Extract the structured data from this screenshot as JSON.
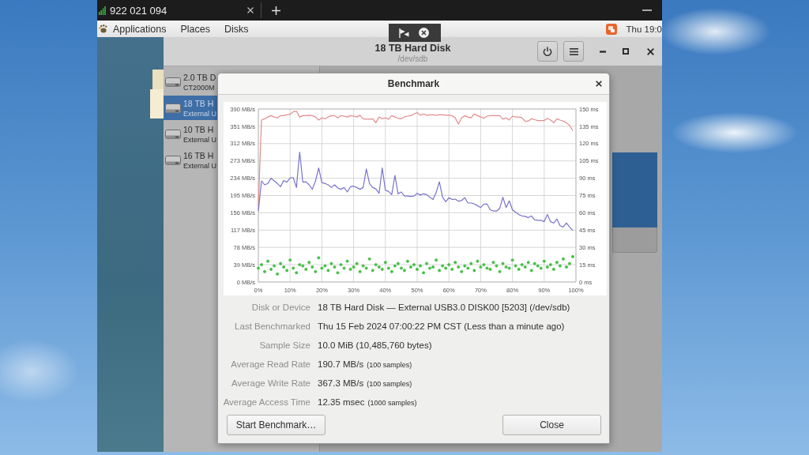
{
  "tab_bar": {
    "tab_title": "922 021 094"
  },
  "top_panel": {
    "menus": [
      "Applications",
      "Places",
      "Disks"
    ],
    "clock": "Thu 19:0"
  },
  "disks_window": {
    "title": "18 TB Hard Disk",
    "subtitle": "/dev/sdb",
    "sidebar": {
      "items": [
        {
          "name": "2.0 TB D",
          "detail": "CT2000M",
          "selected": false
        },
        {
          "name": "18 TB H",
          "detail": "External U",
          "selected": true
        },
        {
          "name": "10 TB H",
          "detail": "External U",
          "selected": false
        },
        {
          "name": "16 TB H",
          "detail": "External U",
          "selected": false
        }
      ]
    }
  },
  "benchmark_dialog": {
    "title": "Benchmark",
    "chart_data": {
      "type": "line",
      "grid": true,
      "xlim": [
        0,
        100
      ],
      "ylim": [
        0,
        390
      ],
      "y2lim": [
        0,
        150
      ],
      "x": [
        0,
        1,
        2,
        3,
        4,
        5,
        6,
        7,
        8,
        9,
        10,
        11,
        12,
        13,
        14,
        15,
        16,
        17,
        18,
        19,
        20,
        21,
        22,
        23,
        24,
        25,
        26,
        27,
        28,
        29,
        30,
        31,
        32,
        33,
        34,
        35,
        36,
        37,
        38,
        39,
        40,
        41,
        42,
        43,
        44,
        45,
        46,
        47,
        48,
        49,
        50,
        51,
        52,
        53,
        54,
        55,
        56,
        57,
        58,
        59,
        60,
        61,
        62,
        63,
        64,
        65,
        66,
        67,
        68,
        69,
        70,
        71,
        72,
        73,
        74,
        75,
        76,
        77,
        78,
        79,
        80,
        81,
        82,
        83,
        84,
        85,
        86,
        87,
        88,
        89,
        90,
        91,
        92,
        93,
        94,
        95,
        96,
        97,
        98,
        99
      ],
      "xticks": [
        {
          "value": 0,
          "label": "0%"
        },
        {
          "value": 10,
          "label": "10%"
        },
        {
          "value": 20,
          "label": "20%"
        },
        {
          "value": 30,
          "label": "30%"
        },
        {
          "value": 40,
          "label": "40%"
        },
        {
          "value": 50,
          "label": "50%"
        },
        {
          "value": 60,
          "label": "60%"
        },
        {
          "value": 70,
          "label": "70%"
        },
        {
          "value": 80,
          "label": "80%"
        },
        {
          "value": 90,
          "label": "90%"
        },
        {
          "value": 100,
          "label": "100%"
        }
      ],
      "yticks": [
        {
          "value": 0,
          "label": "0 MB/s"
        },
        {
          "value": 39,
          "label": "39 MB/s"
        },
        {
          "value": 78,
          "label": "78 MB/s"
        },
        {
          "value": 117,
          "label": "117 MB/s"
        },
        {
          "value": 156,
          "label": "156 MB/s"
        },
        {
          "value": 195,
          "label": "195 MB/s"
        },
        {
          "value": 234,
          "label": "234 MB/s"
        },
        {
          "value": 273,
          "label": "273 MB/s"
        },
        {
          "value": 312,
          "label": "312 MB/s"
        },
        {
          "value": 351,
          "label": "351 MB/s"
        },
        {
          "value": 390,
          "label": "390 MB/s"
        }
      ],
      "y2ticks": [
        {
          "value": 0,
          "label": "0 ms"
        },
        {
          "value": 15,
          "label": "15 ms"
        },
        {
          "value": 30,
          "label": "30 ms"
        },
        {
          "value": 45,
          "label": "45 ms"
        },
        {
          "value": 60,
          "label": "60 ms"
        },
        {
          "value": 75,
          "label": "75 ms"
        },
        {
          "value": 90,
          "label": "90 ms"
        },
        {
          "value": 105,
          "label": "105 ms"
        },
        {
          "value": 120,
          "label": "120 ms"
        },
        {
          "value": 135,
          "label": "135 ms"
        },
        {
          "value": 150,
          "label": "150 ms"
        }
      ],
      "series": [
        {
          "color": "#e38c8c",
          "values": [
            170,
            365,
            368,
            372,
            375,
            372,
            370,
            375,
            375,
            377,
            378,
            384,
            385,
            372,
            375,
            375,
            376,
            375,
            372,
            365,
            370,
            368,
            372,
            375,
            375,
            370,
            375,
            374,
            372,
            375,
            374,
            372,
            376,
            368,
            367,
            367,
            368,
            359,
            372,
            368,
            370,
            367,
            375,
            372,
            369,
            368,
            372,
            374,
            375,
            379,
            382,
            376,
            379,
            376,
            377,
            377,
            376,
            377,
            377,
            376,
            376,
            375,
            370,
            356,
            370,
            375,
            372,
            370,
            379,
            375,
            372,
            369,
            374,
            375,
            375,
            375,
            375,
            367,
            370,
            365,
            374,
            372,
            372,
            370,
            362,
            363,
            368,
            366,
            364,
            364,
            364,
            369,
            365,
            359,
            368,
            365,
            363,
            359,
            353,
            341
          ]
        },
        {
          "color": "#7873cc",
          "values": [
            160,
            228,
            219,
            222,
            234,
            228,
            222,
            215,
            229,
            225,
            235,
            235,
            213,
            293,
            225,
            226,
            219,
            209,
            228,
            257,
            224,
            222,
            219,
            213,
            219,
            212,
            209,
            213,
            203,
            215,
            216,
            213,
            209,
            213,
            255,
            222,
            213,
            210,
            200,
            257,
            207,
            204,
            197,
            240,
            199,
            203,
            194,
            194,
            193,
            194,
            200,
            196,
            199,
            197,
            191,
            186,
            202,
            226,
            191,
            181,
            190,
            186,
            187,
            182,
            184,
            190,
            178,
            178,
            176,
            172,
            168,
            175,
            176,
            163,
            160,
            160,
            166,
            191,
            168,
            183,
            163,
            157,
            152,
            149,
            148,
            145,
            149,
            140,
            139,
            139,
            136,
            152,
            136,
            133,
            142,
            127,
            124,
            133,
            124,
            116
          ]
        },
        {
          "type": "scatter",
          "axis": "y2",
          "color": "#46bf46",
          "values": [
            12,
            15,
            9,
            18,
            11,
            14,
            7,
            16,
            13,
            10,
            19,
            12,
            8,
            15,
            14,
            11,
            17,
            13,
            9,
            21,
            12,
            14,
            10,
            16,
            13,
            8,
            15,
            12,
            18,
            11,
            13,
            16,
            9,
            14,
            12,
            20,
            10,
            15,
            13,
            11,
            17,
            12,
            9,
            14,
            16,
            12,
            10,
            18,
            13,
            15,
            11,
            14,
            8,
            16,
            12,
            13,
            19,
            10,
            14,
            12,
            15,
            11,
            17,
            13,
            9,
            14,
            12,
            16,
            10,
            18,
            13,
            15,
            12,
            11,
            17,
            14,
            9,
            16,
            13,
            12,
            19,
            14,
            11,
            15,
            13,
            17,
            10,
            16,
            14,
            12,
            18,
            13,
            15,
            11,
            17,
            14,
            20,
            13,
            16,
            22
          ]
        }
      ]
    },
    "details": [
      {
        "label": "Disk or Device",
        "value": "18 TB Hard Disk — External USB3.0 DISK00 [5203] (/dev/sdb)"
      },
      {
        "label": "Last Benchmarked",
        "value": "Thu 15 Feb 2024 07:00:22 PM CST (Less than a minute ago)"
      },
      {
        "label": "Sample Size",
        "value": "10.0 MiB (10,485,760 bytes)"
      },
      {
        "label": "Average Read Rate",
        "value": "190.7 MB/s",
        "note": "(100 samples)"
      },
      {
        "label": "Average Write Rate",
        "value": "367.3 MB/s",
        "note": "(100 samples)"
      },
      {
        "label": "Average Access Time",
        "value": "12.35 msec",
        "note": "(1000 samples)"
      }
    ],
    "buttons": [
      "Start Benchmark…",
      "Close"
    ]
  }
}
